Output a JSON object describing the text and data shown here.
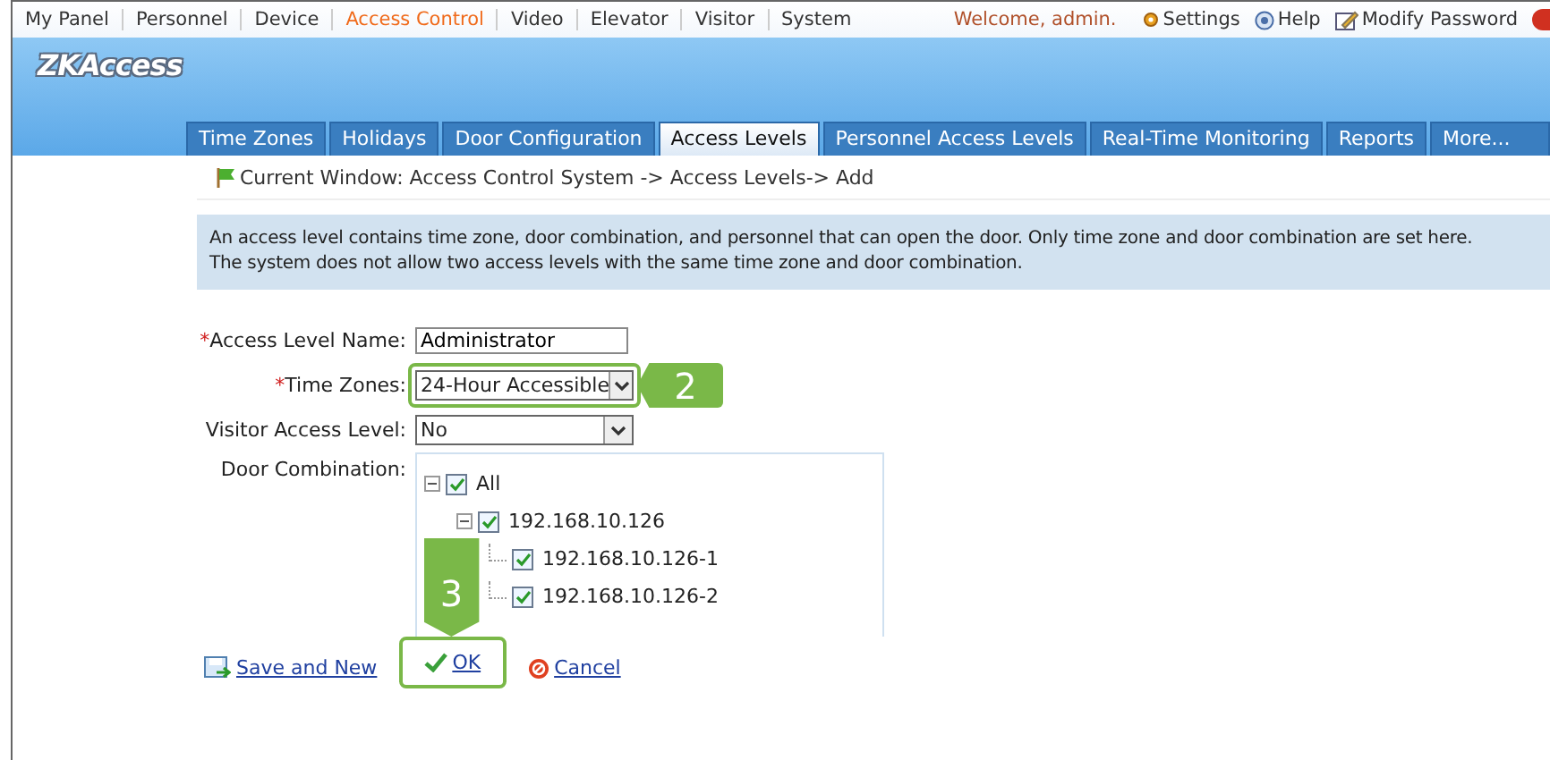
{
  "top_menu": [
    {
      "label": "My Panel",
      "selected": false
    },
    {
      "label": "Personnel",
      "selected": false
    },
    {
      "label": "Device",
      "selected": false
    },
    {
      "label": "Access Control",
      "selected": true
    },
    {
      "label": "Video",
      "selected": false
    },
    {
      "label": "Elevator",
      "selected": false
    },
    {
      "label": "Visitor",
      "selected": false
    },
    {
      "label": "System",
      "selected": false
    }
  ],
  "welcome": "Welcome, admin.",
  "user_links": [
    {
      "kind": "settings",
      "label": "Settings"
    },
    {
      "kind": "help",
      "label": "Help"
    },
    {
      "kind": "password",
      "label": "Modify Password"
    }
  ],
  "logo": "ZKAccess",
  "tabs": [
    {
      "label": "Time Zones",
      "selected": false
    },
    {
      "label": "Holidays",
      "selected": false
    },
    {
      "label": "Door Configuration",
      "selected": false
    },
    {
      "label": "Access Levels",
      "selected": true
    },
    {
      "label": "Personnel Access Levels",
      "selected": false
    },
    {
      "label": "Real-Time Monitoring",
      "selected": false
    },
    {
      "label": "Reports",
      "selected": false
    },
    {
      "label": "More...",
      "selected": false
    }
  ],
  "breadcrumb": "Current Window: Access Control System -> Access Levels-> Add",
  "info": [
    "An access level contains time zone, door combination, and personnel that can open the door. Only time zone and door combination are set here.",
    "The system does not allow two access levels with the same time zone and door combination."
  ],
  "form": {
    "fields": [
      {
        "kind": "text",
        "label": "Access Level Name:",
        "required_mark": "*",
        "value": "Administrator",
        "highlighted": false
      },
      {
        "kind": "select",
        "label": "Time Zones:",
        "required_mark": "*",
        "value": "24-Hour Accessible",
        "highlighted": true,
        "callout": "2"
      },
      {
        "kind": "select",
        "label": "Visitor Access Level:",
        "value": "No",
        "highlighted": false
      }
    ],
    "door_label": "Door Combination:",
    "door_tree": [
      {
        "label": "All",
        "checked": true,
        "expanded": true,
        "children": [
          {
            "label": "192.168.10.126",
            "checked": true,
            "expanded": true,
            "children": [
              {
                "label": "192.168.10.126-1",
                "checked": true
              },
              {
                "label": "192.168.10.126-2",
                "checked": true
              }
            ]
          }
        ]
      }
    ]
  },
  "buttons": [
    {
      "kind": "save_new",
      "label": "Save and New",
      "highlighted": false
    },
    {
      "kind": "ok",
      "label": "OK",
      "highlighted": true,
      "callout": "3"
    },
    {
      "kind": "cancel",
      "label": "Cancel",
      "highlighted": false
    }
  ]
}
